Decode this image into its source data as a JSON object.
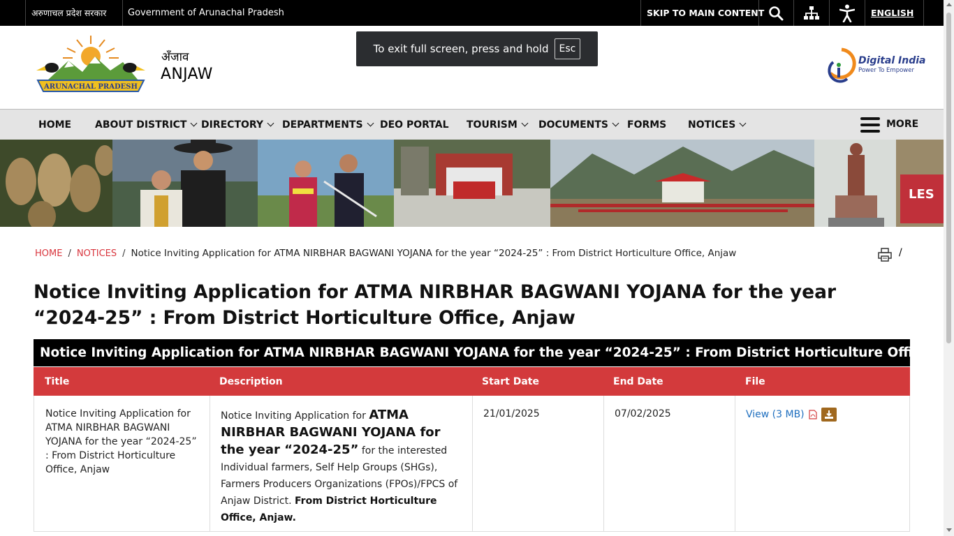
{
  "topbar": {
    "state_hindi": "अरुणाचल प्रदेश सरकार",
    "state_english": "Government of Arunachal Pradesh",
    "skip_label": "SKIP TO MAIN CONTENT",
    "search_icon": "search-icon",
    "sitemap_icon": "sitemap-icon",
    "accessibility_icon": "accessibility-icon",
    "language_label": "ENGLISH"
  },
  "header": {
    "logo_text": "ARUNACHAL PRADESH",
    "site_name_hindi": "अँजाव",
    "site_name": "ANJAW",
    "fullscreen_message": "To exit full screen, press and hold",
    "fullscreen_key": "Esc",
    "digital_india_title": "Digital India",
    "digital_india_tagline": "Power To Empower"
  },
  "nav": {
    "items": [
      {
        "label": "HOME",
        "dropdown": false
      },
      {
        "label": "ABOUT DISTRICT",
        "dropdown": true
      },
      {
        "label": "DIRECTORY",
        "dropdown": true
      },
      {
        "label": "DEPARTMENTS",
        "dropdown": true
      },
      {
        "label": "DEO PORTAL",
        "dropdown": false
      },
      {
        "label": "TOURISM",
        "dropdown": true
      },
      {
        "label": "DOCUMENTS",
        "dropdown": true
      },
      {
        "label": "FORMS",
        "dropdown": false
      },
      {
        "label": "NOTICES",
        "dropdown": true
      }
    ],
    "more_label": "MORE"
  },
  "breadcrumb": {
    "home": "HOME",
    "notices": "NOTICES",
    "current": "Notice Inviting Application for ATMA NIRBHAR BAGWANI YOJANA for the year “2024-25” : From District Horticulture Office, Anjaw",
    "trailing": "/"
  },
  "page_title": "Notice Inviting Application for ATMA NIRBHAR BAGWANI YOJANA for the year “2024-25” : From District Horticulture Office, Anjaw",
  "table": {
    "caption": "Notice Inviting Application for ATMA NIRBHAR BAGWANI YOJANA for the year “2024-25” : From District Horticulture Office, Anjaw",
    "headers": [
      "Title",
      "Description",
      "Start Date",
      "End Date",
      "File"
    ],
    "rows": [
      {
        "title": "Notice Inviting Application for ATMA NIRBHAR BAGWANI YOJANA for the year “2024-25” : From District Horticulture Office, Anjaw",
        "desc_prefix": "Notice Inviting Application for ",
        "desc_bold": "ATMA NIRBHAR BAGWANI YOJANA for the year “2024-25”",
        "desc_middle": " for the interested Individual farmers, Self Help Groups (SHGs), Farmers Producers Organizations (FPOs)/FPCS of Anjaw District. ",
        "desc_end_bold": "From District Horticulture Office, Anjaw.",
        "start_date": "21/01/2025",
        "end_date": "07/02/2025",
        "file_label": "View (3 MB)",
        "file_icon": "pdf-icon",
        "download_icon": "download-icon"
      }
    ]
  },
  "colors": {
    "accent_red": "#d33a3c",
    "link_blue": "#1f6fbf",
    "download_brown": "#a0681e"
  }
}
